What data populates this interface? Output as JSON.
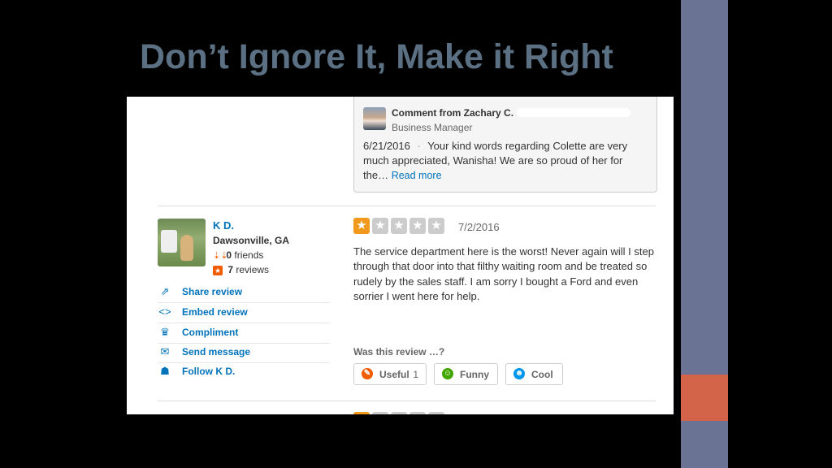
{
  "slide": {
    "title": "Don’t Ignore It, Make it Right"
  },
  "comment": {
    "from": "Comment from Zachary C.",
    "role": "Business Manager",
    "date": "6/21/2016",
    "separator": "·",
    "text": "Your kind words regarding Colette are very much appreciated, Wanisha! We are so proud of her for the…",
    "read_more": "Read more"
  },
  "reviewer": {
    "name": "K D.",
    "location": "Dawsonville, GA",
    "friends_count": "0",
    "friends_label": "friends",
    "reviews_count": "7",
    "reviews_label": "reviews"
  },
  "actions": [
    {
      "label": "Share review",
      "icon": "share-icon"
    },
    {
      "label": "Embed review",
      "icon": "embed-icon"
    },
    {
      "label": "Compliment",
      "icon": "compliment-icon"
    },
    {
      "label": "Send message",
      "icon": "message-icon"
    },
    {
      "label": "Follow K D.",
      "icon": "follow-icon"
    }
  ],
  "review": {
    "rating": 1,
    "max_rating": 5,
    "date": "7/2/2016",
    "text": "The service department here is the worst! Never again will I step through that door into that filthy waiting room and be treated so rudely by the sales staff. I am sorry I bought a Ford and even sorrier I went here for help.",
    "was_helpful_label": "Was this review …?",
    "votes": {
      "useful_label": "Useful",
      "useful_count": "1",
      "funny_label": "Funny",
      "cool_label": "Cool"
    }
  },
  "colors": {
    "link": "#0073bb",
    "star": "#f0991c",
    "title": "#5b7083",
    "side_bar": "#6b7394",
    "accent": "#d3644a"
  }
}
